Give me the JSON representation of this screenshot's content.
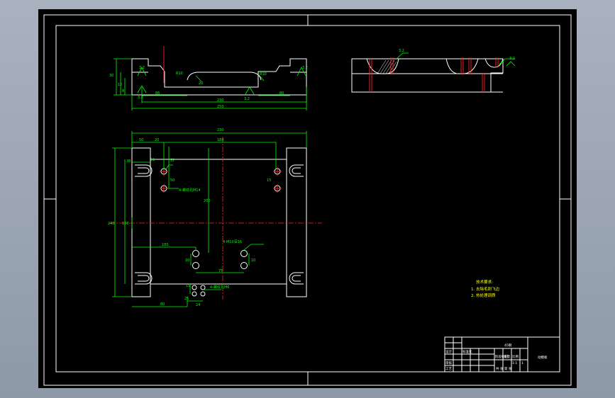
{
  "top_view_dims": {
    "height_left": "30",
    "small_left": "10",
    "left_depth": "8",
    "slot_width": "86",
    "slot_depth": "20",
    "right_slot": "80",
    "radius_left": "R10",
    "radius_right": "R10",
    "inner_width": "230",
    "outer_width": "250",
    "roughness_1": "3.2",
    "roughness_2": "3.2",
    "roughness_3": "3.2",
    "roughness_4": "3.2"
  },
  "side_view_dims": {
    "roughness_a": "3.2",
    "roughness_b": "3.2"
  },
  "plan_view_dims": {
    "overall_width": "230",
    "overall_height": "240",
    "center_height": "130",
    "left_offset": "50",
    "hole_offset": "20",
    "ref_180": "180",
    "ref_200": "200",
    "v_57": "57",
    "v_50": "50",
    "d_11": "11",
    "hole_note_1": "4-螺纹孔M14",
    "v_15": "15",
    "dim_180b": "180",
    "hole_note_2": "4-M10深16",
    "v_10a": "10",
    "v_10b": "10",
    "d_75": "75",
    "hole_note_3": "4-螺纹孔M6",
    "bottom_80": "80",
    "bottom_24": "24",
    "small_15": "15",
    "small_25": "25",
    "v_38": "38"
  },
  "tech_notes": {
    "title": "技术要求:",
    "line1": "1. 去除毛刺飞边",
    "line2": "2. 热处理调质"
  },
  "title_block": {
    "part_name": "动模板",
    "material": "45钢",
    "scale": "1:1",
    "sheet": "1",
    "label_a": "设计",
    "label_b": "审核",
    "label_c": "工艺",
    "label_d": "标准化",
    "label_e": "阶段标记",
    "label_f": "重量",
    "label_g": "比例",
    "label_h": "共 张 第 张"
  },
  "colors": {
    "background": "#000000",
    "outline": "#ffffff",
    "dimension": "#00ff00",
    "centerline": "#ff2020",
    "text_note": "#ffff00"
  }
}
